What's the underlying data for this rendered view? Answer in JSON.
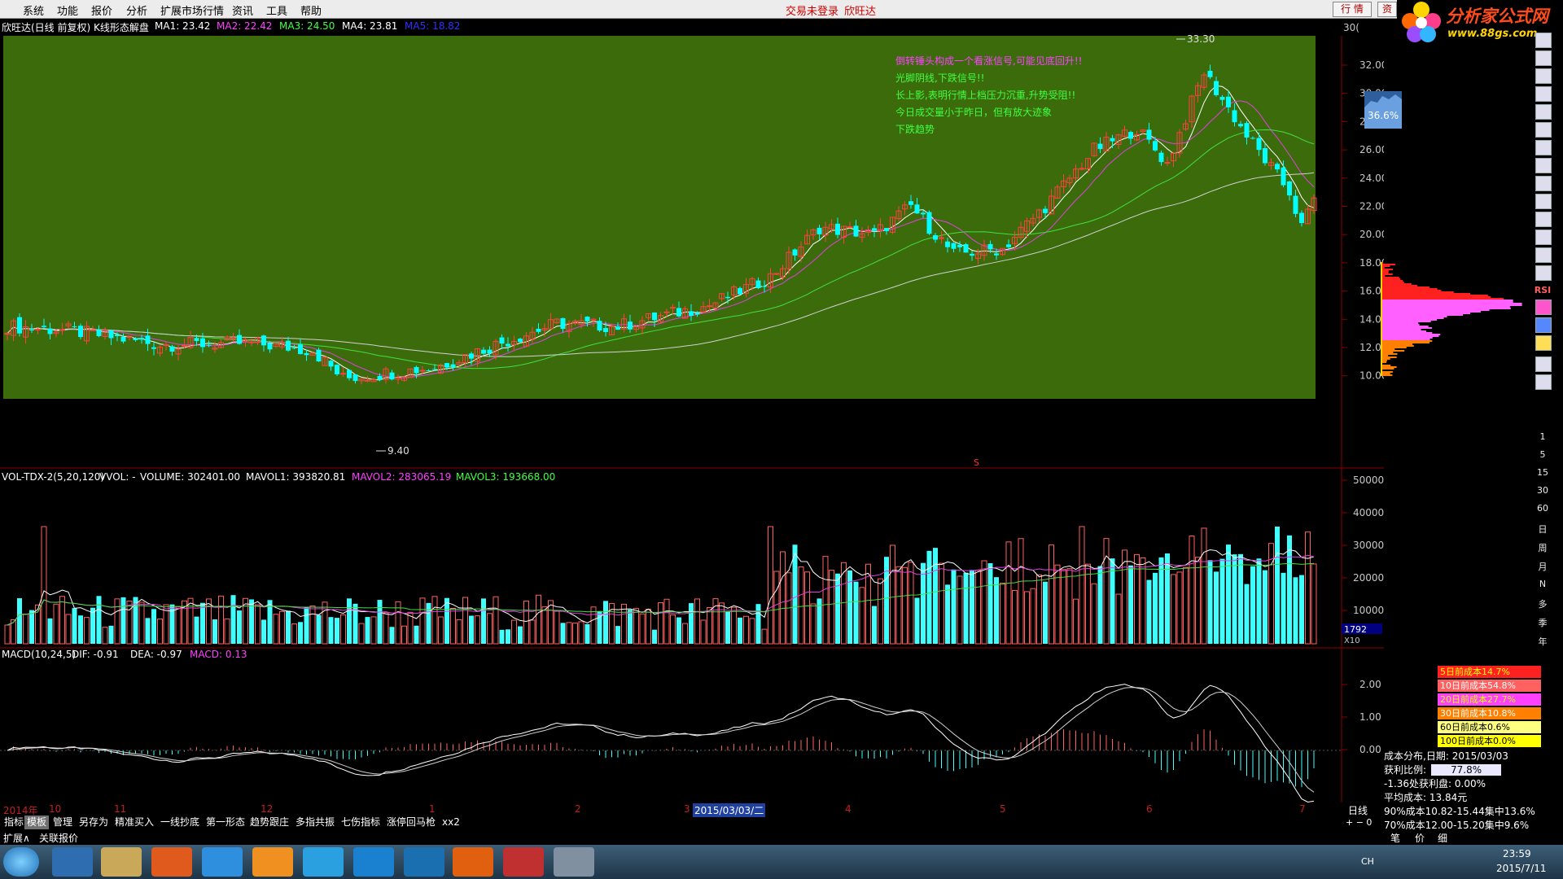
{
  "menu": {
    "items": [
      "系统",
      "功能",
      "报价",
      "分析",
      "扩展市场行情",
      "资讯",
      "工具",
      "帮助"
    ],
    "status_left": "交易未登录",
    "status_right": "欣旺达",
    "btn_quote": "行 情",
    "btn_zi": "资"
  },
  "logo": {
    "title": "分析家公式网",
    "url_text": "www.88gs.com"
  },
  "main": {
    "title": "欣旺达(日线 前复权) K线形态解盘",
    "ma": [
      {
        "label": "MA1: 23.42",
        "color": "#ffffff"
      },
      {
        "label": "MA2: 22.42",
        "color": "#ff40ff"
      },
      {
        "label": "MA3: 24.50",
        "color": "#40ff40"
      },
      {
        "label": "MA4: 23.81",
        "color": "#ffffff"
      },
      {
        "label": "MA5: 18.82",
        "color": "#3030ff"
      }
    ],
    "annotations": [
      {
        "text": "倒转锤头构成一个看涨信号,可能见底回升!!",
        "color": "#ff40ff"
      },
      {
        "text": "光脚阴线,下跌信号!!",
        "color": "#40ff40"
      },
      {
        "text": "长上影,表明行情上档压力沉重,升势受阻!!",
        "color": "#40ff40"
      },
      {
        "text": "今日成交量小于昨日，但有放大迹象",
        "color": "#40ff40"
      },
      {
        "text": "下跌趋势",
        "color": "#40ff40"
      }
    ],
    "high_label": "33.30",
    "low_label": "9.40",
    "yaxis": [
      "32.00",
      "30.00",
      "28.00",
      "26.00",
      "24.00",
      "22.00",
      "20.00",
      "18.00",
      "16.00",
      "14.00",
      "12.00",
      "10.00"
    ],
    "top_axis_label": "30(",
    "profit_badge": "36.6%",
    "s_marker": "S",
    "colors": {
      "panel_bg": "#3c6b0c",
      "up": "#ff4040",
      "down": "#00ffff",
      "ma1": "#ffffff",
      "ma2": "#e040e0",
      "ma3": "#40e040",
      "ma4": "#d0d0d0",
      "grid": "#8b0000"
    }
  },
  "volume": {
    "title": "VOL-TDX-2(5,20,120)",
    "vvol": "VVOL: -",
    "volume": "VOLUME: 302401.00",
    "mavol1": "MAVOL1: 393820.81",
    "mavol2": "MAVOL2: 283065.19",
    "mavol3": "MAVOL3: 193668.00",
    "yaxis": [
      "50000",
      "40000",
      "30000",
      "20000",
      "10000"
    ],
    "cursor_value": "1792",
    "unit": "X10"
  },
  "macd": {
    "title": "MACD(10,24,5)",
    "dif": "DIF: -0.91",
    "dea": "DEA: -0.97",
    "macd": "MACD: 0.13",
    "yaxis": [
      "2.00",
      "1.00",
      "0.00"
    ]
  },
  "timeaxis": {
    "labels": [
      "2014年",
      "10",
      "11",
      "12",
      "1",
      "2",
      "3",
      "2015/03/03/二",
      "4",
      "5",
      "6",
      "7"
    ],
    "period": "日线"
  },
  "tabs": [
    "指标",
    "模板",
    "管理",
    "另存为",
    "精准买入",
    "一线抄底",
    "第一形态",
    "趋势跟庄",
    "多指共振",
    "七伤指标",
    "涨停回马枪",
    "xx2"
  ],
  "active_tab": "模板",
  "expand": {
    "label": "扩展∧",
    "related": "关联报价"
  },
  "right_tools": {
    "periods": [
      "1",
      "5",
      "15",
      "30",
      "60",
      "日",
      "周",
      "月",
      "N",
      "多",
      "季",
      "年"
    ],
    "rsi": "RSI"
  },
  "cost": {
    "rows": [
      {
        "label": "5日前成本14.7%",
        "bg": "#ff2020",
        "fg": "#ffff00"
      },
      {
        "label": "10日前成本54.8%",
        "bg": "#ff6060",
        "fg": "#ffffff"
      },
      {
        "label": "20日前成本27.7%",
        "bg": "#ff40ff",
        "fg": "#ffff00"
      },
      {
        "label": "30日前成本10.8%",
        "bg": "#ff7f00",
        "fg": "#ffffff"
      },
      {
        "label": "60日前成本0.6%",
        "bg": "#ffff80",
        "fg": "#000000"
      },
      {
        "label": "100日前成本0.0%",
        "bg": "#ffff00",
        "fg": "#000000"
      }
    ],
    "dist_title": "成本分布,日期:",
    "dist_date": "2015/03/03",
    "profit_label": "获利比例:",
    "profit_value": "77.8%",
    "loss_line": "-1.36处获利盘: 0.00%",
    "avg_cost": "平均成本: 13.84元",
    "conc90": "90%成本10.82-15.44集中13.6%",
    "conc70": "70%成本12.00-15.20集中9.6%"
  },
  "bottom_right": [
    "笔",
    "价",
    "细"
  ],
  "taskbar": {
    "time": "23:59",
    "date": "2015/7/11",
    "lang": "CH"
  }
}
